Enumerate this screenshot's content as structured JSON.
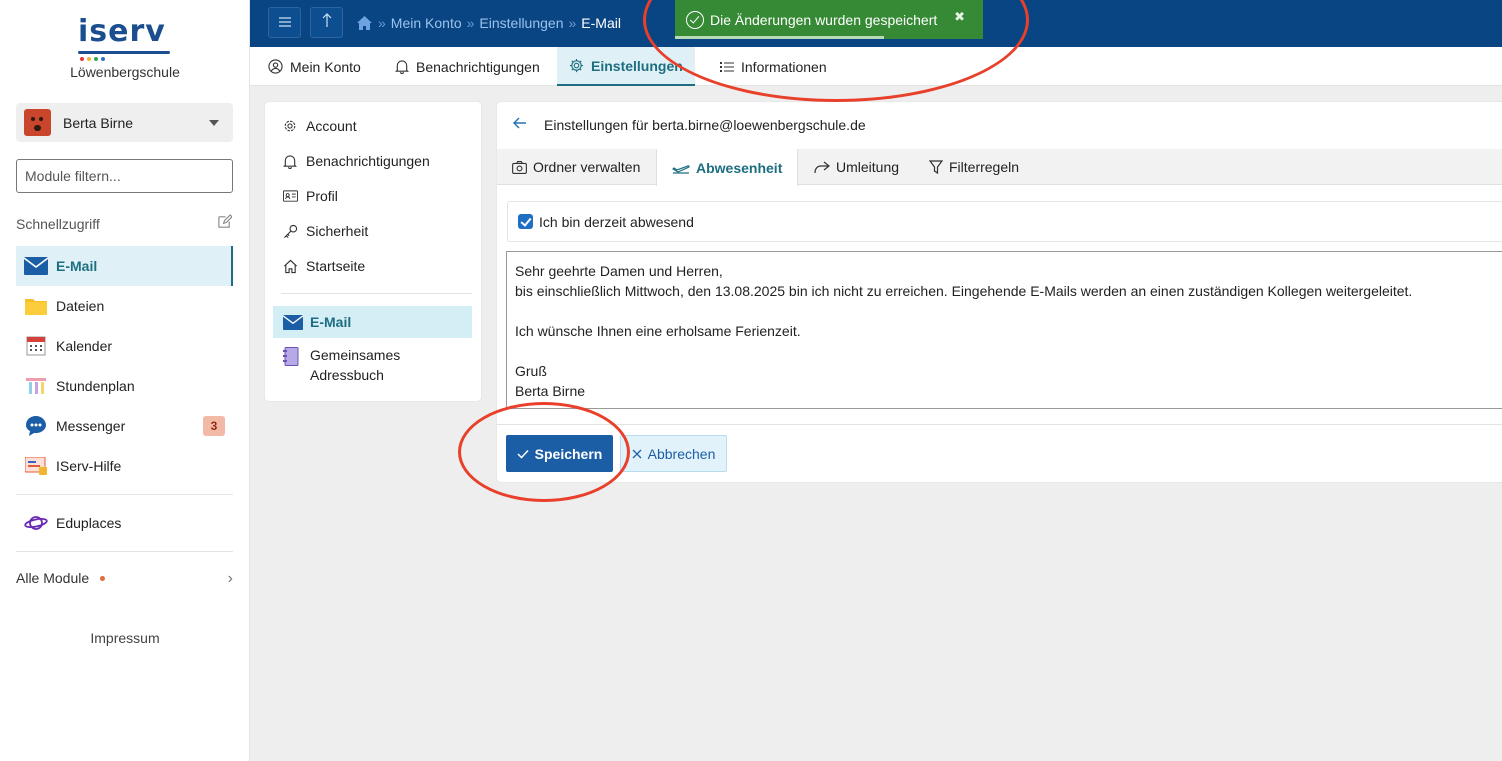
{
  "logo": {
    "text": "iserv"
  },
  "sidebar": {
    "school_name": "Löwenbergschule",
    "user_name": "Berta Birne",
    "filter_placeholder": "Module filtern...",
    "quick_access_title": "Schnellzugriff",
    "items": [
      {
        "label": "E-Mail",
        "icon": "mail-icon",
        "active": true
      },
      {
        "label": "Dateien",
        "icon": "folder-icon"
      },
      {
        "label": "Kalender",
        "icon": "calendar-icon"
      },
      {
        "label": "Stundenplan",
        "icon": "timetable-icon"
      },
      {
        "label": "Messenger",
        "icon": "messenger-icon",
        "badge": "3"
      },
      {
        "label": "IServ-Hilfe",
        "icon": "help-icon"
      }
    ],
    "extra_item": {
      "label": "Eduplaces",
      "icon": "planet-icon"
    },
    "all_modules": "Alle Module",
    "impressum": "Impressum"
  },
  "header": {
    "breadcrumb": [
      "Mein Konto",
      "Einstellungen",
      "E-Mail"
    ],
    "toast": "Die Änderungen wurden gespeichert",
    "toast_close": "✖",
    "toast_progress": 0.68
  },
  "subnav": {
    "tabs": [
      {
        "label": "Mein Konto",
        "icon": "user-circle-icon"
      },
      {
        "label": "Benachrichtigungen",
        "icon": "bell-icon"
      },
      {
        "label": "Einstellungen",
        "icon": "gear-icon",
        "active": true
      },
      {
        "label": "Informationen",
        "icon": "list-icon"
      }
    ]
  },
  "settings_nav": {
    "items": [
      {
        "label": "Account",
        "icon": "gear-icon"
      },
      {
        "label": "Benachrichtigungen",
        "icon": "bell-icon"
      },
      {
        "label": "Profil",
        "icon": "id-card-icon"
      },
      {
        "label": "Sicherheit",
        "icon": "key-icon"
      },
      {
        "label": "Startseite",
        "icon": "home-icon"
      }
    ],
    "module_items": [
      {
        "label": "E-Mail",
        "icon": "mail-icon",
        "active": true
      },
      {
        "label": "Gemeinsames Adressbuch",
        "icon": "addressbook-icon"
      }
    ]
  },
  "panel": {
    "title": "Einstellungen für berta.birne@loewenbergschule.de",
    "tabs": [
      {
        "label": "Ordner verwalten",
        "icon": "camera-icon"
      },
      {
        "label": "Abwesenheit",
        "icon": "plane-icon",
        "active": true
      },
      {
        "label": "Umleitung",
        "icon": "forward-icon"
      },
      {
        "label": "Filterregeln",
        "icon": "filter-icon"
      }
    ],
    "checkbox_label": "Ich bin derzeit abwesend",
    "checkbox_checked": true,
    "message_lines": [
      "Sehr geehrte Damen und Herren,",
      "bis einschließlich Mittwoch, den 13.08.2025 bin ich nicht zu erreichen. Eingehende E-Mails werden an einen zuständigen Kollegen weitergeleitet.",
      "",
      "Ich wünsche Ihnen eine erholsame Ferienzeit.",
      "",
      "Gruß",
      "Berta Birne"
    ],
    "save_label": "Speichern",
    "cancel_label": "Abbrechen"
  },
  "colors": {
    "header": "#084582",
    "accent": "#1d6e81",
    "active_bg": "#dff1f6",
    "toast": "#368a35",
    "save": "#1c5ea5",
    "annotation": "#e8402a"
  }
}
